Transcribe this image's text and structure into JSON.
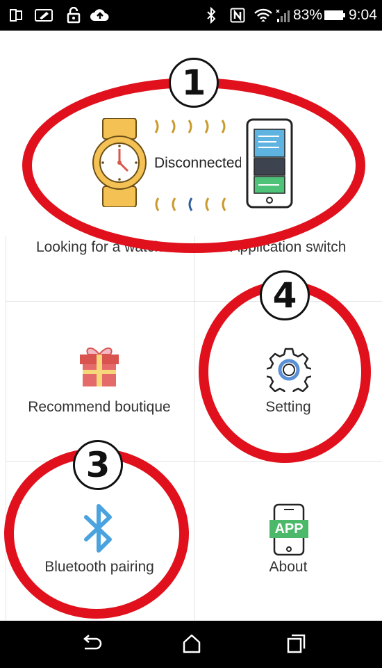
{
  "status_bar": {
    "battery_percent": "83%",
    "time": "9:04",
    "icons": [
      "screen-mirror-icon",
      "edit-icon",
      "lock-icon",
      "cloud-upload-icon",
      "bluetooth-icon",
      "nfc-icon",
      "wifi-icon",
      "signal-icon",
      "battery-icon"
    ]
  },
  "connection": {
    "status": "Disconnected",
    "left_icon": "watch-icon",
    "right_icon": "phone-icon"
  },
  "menu": {
    "items": [
      {
        "label": "Looking for a watch",
        "icon": "search-watch-icon"
      },
      {
        "label": "Application switch",
        "icon": "app-switch-icon"
      },
      {
        "label": "Recommend boutique",
        "icon": "gift-icon"
      },
      {
        "label": "Setting",
        "icon": "gear-icon"
      },
      {
        "label": "Bluetooth pairing",
        "icon": "bluetooth-icon"
      },
      {
        "label": "About",
        "icon": "app-icon"
      }
    ],
    "app_badge": "APP"
  },
  "annotations": {
    "badges": [
      "1",
      "3",
      "4"
    ],
    "color": "#e0111c"
  },
  "nav_bar": {
    "icons": [
      "back-icon",
      "home-icon",
      "recents-icon"
    ]
  }
}
